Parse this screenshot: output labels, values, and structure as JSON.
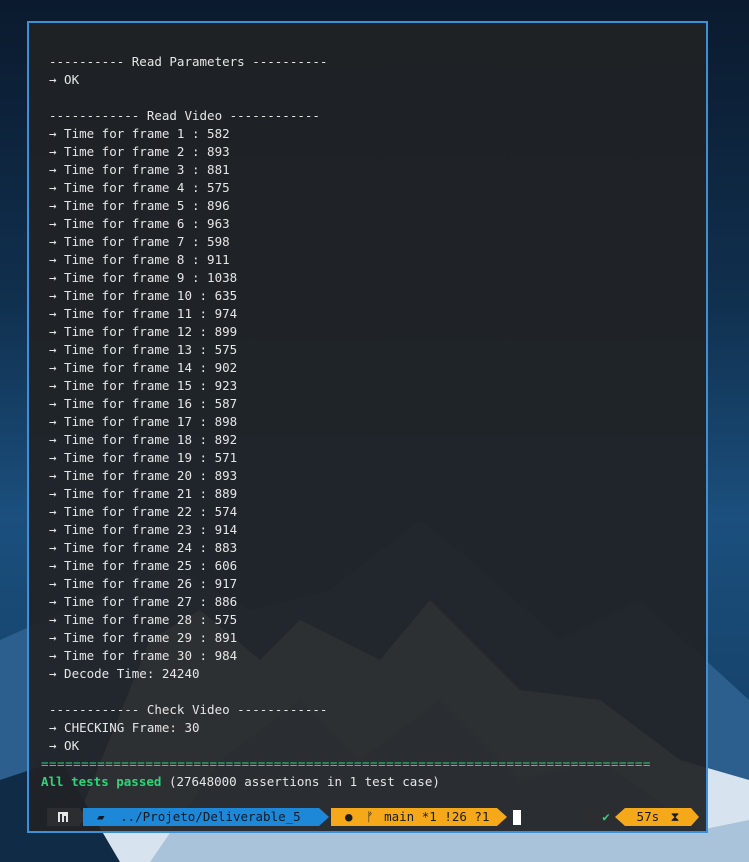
{
  "terminal": {
    "read_params_header": "---------- Read Parameters ----------",
    "read_params_ok": "→ OK",
    "read_video_header": "------------ Read Video ------------",
    "frames": [
      "→ Time for frame 1 : 582",
      "→ Time for frame 2 : 893",
      "→ Time for frame 3 : 881",
      "→ Time for frame 4 : 575",
      "→ Time for frame 5 : 896",
      "→ Time for frame 6 : 963",
      "→ Time for frame 7 : 598",
      "→ Time for frame 8 : 911",
      "→ Time for frame 9 : 1038",
      "→ Time for frame 10 : 635",
      "→ Time for frame 11 : 974",
      "→ Time for frame 12 : 899",
      "→ Time for frame 13 : 575",
      "→ Time for frame 14 : 902",
      "→ Time for frame 15 : 923",
      "→ Time for frame 16 : 587",
      "→ Time for frame 17 : 898",
      "→ Time for frame 18 : 892",
      "→ Time for frame 19 : 571",
      "→ Time for frame 20 : 893",
      "→ Time for frame 21 : 889",
      "→ Time for frame 22 : 574",
      "→ Time for frame 23 : 914",
      "→ Time for frame 24 : 883",
      "→ Time for frame 25 : 606",
      "→ Time for frame 26 : 917",
      "→ Time for frame 27 : 886",
      "→ Time for frame 28 : 575",
      "→ Time for frame 29 : 891",
      "→ Time for frame 30 : 984"
    ],
    "decode_time": "→ Decode Time: 24240",
    "check_video_header": "------------ Check Video ------------",
    "checking_frame": "→ CHECKING Frame: 30",
    "check_ok": "→ OK",
    "separator": "============================================================================",
    "passed_label": "All tests passed",
    "passed_detail": " (27648000 assertions in 1 test case)"
  },
  "prompt": {
    "path": "../Projeto/Deliverable_5",
    "git_branch": "main *1 !26 ?1",
    "status_check": "✔",
    "duration": "57s",
    "colors": {
      "dir_segment": "#1e88d8",
      "git_segment": "#f6a81b",
      "success": "#2fd47a"
    },
    "icons": [
      "linux-icon",
      "folder-icon",
      "github-icon",
      "git-branch-icon",
      "check-icon",
      "hourglass-icon"
    ]
  }
}
